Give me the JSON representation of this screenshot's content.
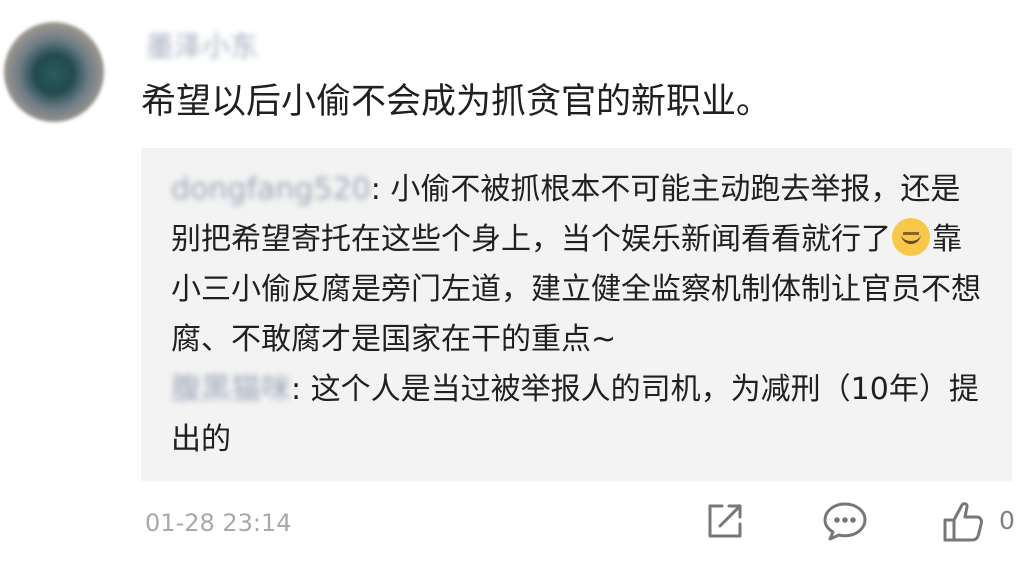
{
  "comment": {
    "username": "墨泽小东",
    "text": "希望以后小偷不会成为抓贪官的新职业。",
    "timestamp": "01-28 23:14"
  },
  "replies": [
    {
      "user": "dongfang520",
      "separator": ": ",
      "text_before_emoji": "小偷不被抓根本不可能主动跑去举报，还是别把希望寄托在这些个身上，当个娱乐新闻看看就行了",
      "emoji": "smile-emoji",
      "text_after_emoji": "靠小三小偷反腐是旁门左道，建立健全监察机制体制让官员不想腐、不敢腐才是国家在干的重点~"
    },
    {
      "user": "腹黑猫咪",
      "separator": ": ",
      "text": "这个人是当过被举报人的司机，为减刑（10年）提出的"
    }
  ],
  "actions": {
    "share_icon": "share-icon",
    "comment_icon": "comment-icon",
    "like_icon": "like-icon",
    "like_count": "0"
  }
}
